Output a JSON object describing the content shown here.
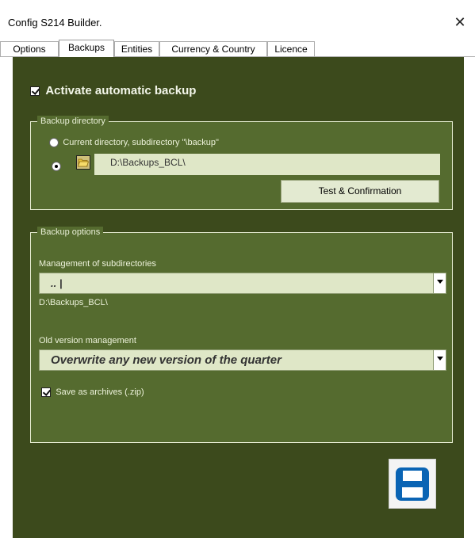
{
  "window": {
    "title": "Config S214 Builder.",
    "close_glyph": "✕"
  },
  "tabs": [
    "Options",
    "Backups",
    "Entities",
    "Currency & Country",
    "Licence"
  ],
  "active_tab": "Backups",
  "activate_backup": {
    "label": "Activate automatic backup",
    "checked": true
  },
  "backup_directory": {
    "legend": "Backup directory",
    "option_current": "Current directory, subdirectory \"\\backup\"",
    "path_value": "D:\\Backups_BCL\\",
    "selected_option": "custom-path",
    "test_button": "Test & Confirmation"
  },
  "backup_options": {
    "legend": "Backup options",
    "subdir_label": "Management of subdirectories",
    "subdir_value": ".. |",
    "subdir_path": "D:\\Backups_BCL\\",
    "old_version_label": "Old version management",
    "old_version_value": "Overwrite any new version of the quarter",
    "save_archives": {
      "label": "Save as archives (.zip)",
      "checked": true
    }
  },
  "icons": {
    "folder": "folder-open-icon",
    "save": "floppy-disk-icon"
  },
  "colors": {
    "panel_bg": "#3c4a1c",
    "frame_bg": "#556b2f",
    "save_button": "#0a64b4"
  }
}
